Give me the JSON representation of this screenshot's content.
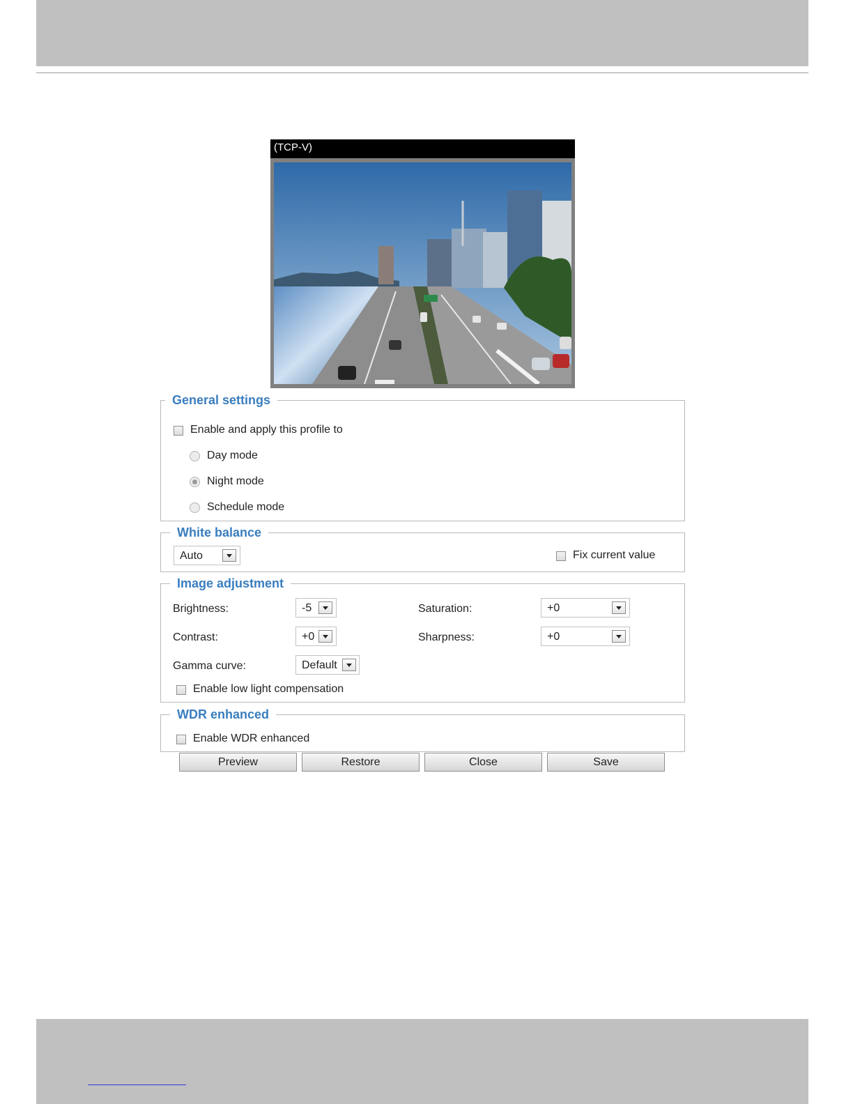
{
  "viewer": {
    "stream_label": "(TCP-V)"
  },
  "general_settings": {
    "title": "General settings",
    "enable_label": "Enable and apply this profile to",
    "enable_checked": false,
    "modes": [
      {
        "label": "Day mode",
        "selected": false
      },
      {
        "label": "Night mode",
        "selected": true
      },
      {
        "label": "Schedule mode",
        "selected": false
      }
    ]
  },
  "white_balance": {
    "title": "White balance",
    "mode_value": "Auto",
    "fix_label": "Fix current value",
    "fix_checked": false
  },
  "image_adjustment": {
    "title": "Image adjustment",
    "brightness": {
      "label": "Brightness:",
      "value": "-5"
    },
    "saturation": {
      "label": "Saturation:",
      "value": "+0"
    },
    "contrast": {
      "label": "Contrast:",
      "value": "+0"
    },
    "sharpness": {
      "label": "Sharpness:",
      "value": "+0"
    },
    "gamma": {
      "label": "Gamma curve:",
      "value": "Default"
    },
    "low_light_label": "Enable low light compensation",
    "low_light_checked": false
  },
  "wdr": {
    "title": "WDR enhanced",
    "enable_label": "Enable WDR enhanced",
    "enable_checked": false
  },
  "buttons": {
    "preview": "Preview",
    "restore": "Restore",
    "close": "Close",
    "save": "Save"
  },
  "colors": {
    "legend_blue": "#3a7ebf",
    "band_gray": "#c0c0c0",
    "link_blue": "#2b3bd6"
  }
}
